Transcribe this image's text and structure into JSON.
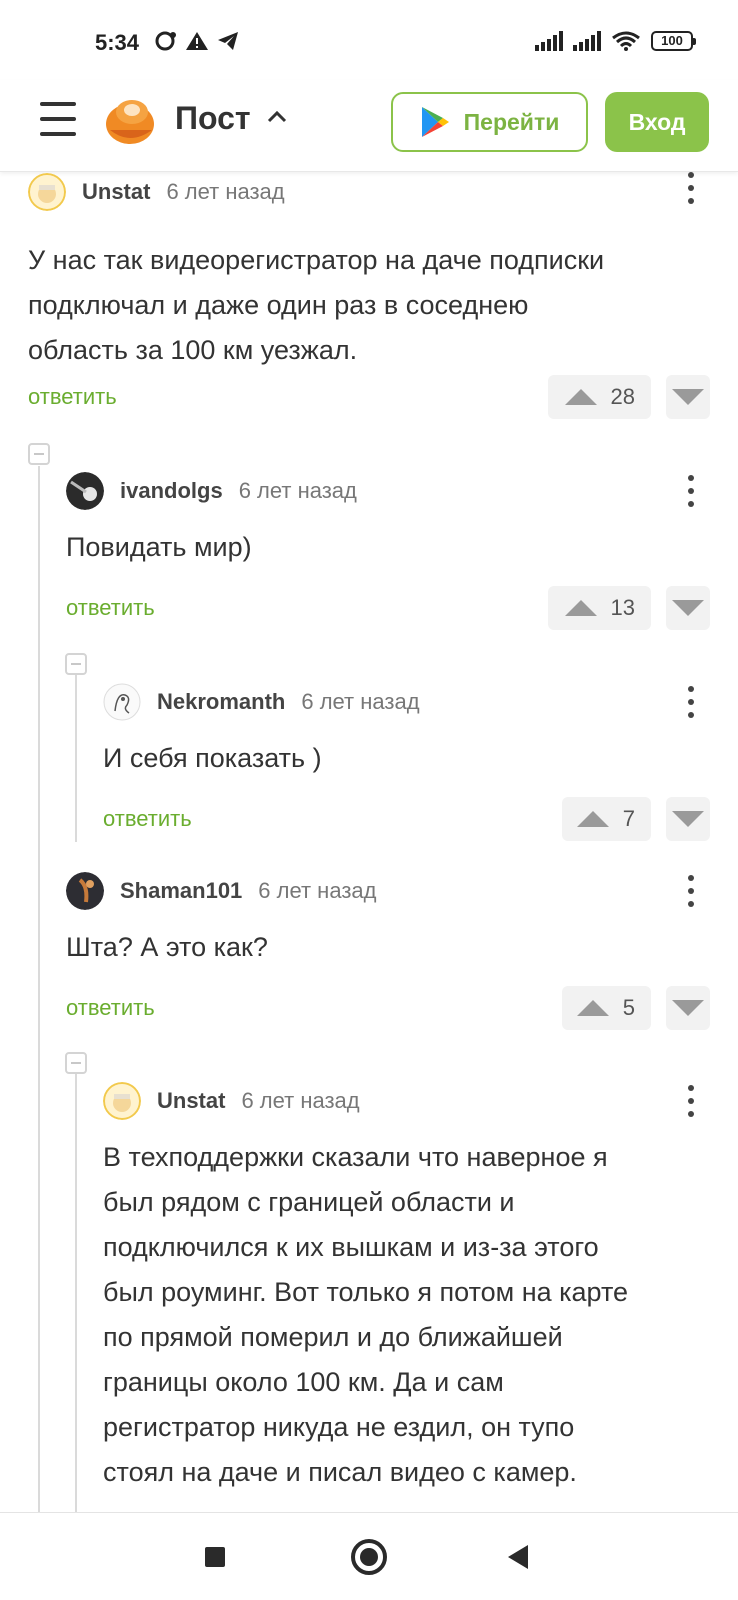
{
  "status_bar": {
    "time": "5:34",
    "battery": "100",
    "icons": [
      "notification-icon",
      "warning-icon",
      "telegram-icon",
      "signal-icon",
      "signal-icon",
      "wifi-icon",
      "battery-icon"
    ]
  },
  "header": {
    "title": "Пост",
    "go_button": "Перейти",
    "login_button": "Вход",
    "accent_color": "#8bc34a"
  },
  "comments": [
    {
      "user": "Unstat",
      "time": "6 лет назад",
      "text_lines": [
        "У нас так видеорегистратор на даче подписки",
        "подключал и даже один раз в соседнею",
        "область за 100 км уезжал."
      ],
      "reply": "ответить",
      "votes": "28"
    },
    {
      "user": "ivandolgs",
      "time": "6 лет назад",
      "text_lines": [
        "Повидать мир)"
      ],
      "reply": "ответить",
      "votes": "13"
    },
    {
      "user": "Nekromanth",
      "time": "6 лет назад",
      "text_lines": [
        "И себя показать )"
      ],
      "reply": "ответить",
      "votes": "7"
    },
    {
      "user": "Shaman101",
      "time": "6 лет назад",
      "text_lines": [
        "Шта? А это как?"
      ],
      "reply": "ответить",
      "votes": "5"
    },
    {
      "user": "Unstat",
      "time": "6 лет назад",
      "text_lines": [
        "В техподдержки сказали что наверное я",
        "был рядом с границей области и",
        "подключился к их вышкам и из-за этого",
        "был роуминг. Вот только я потом на карте",
        "по прямой померил и до ближайшей",
        "границы около 100 км. Да и сам",
        "регистратор никуда не ездил, он тупо",
        "стоял на даче и писал видео с камер."
      ]
    }
  ]
}
